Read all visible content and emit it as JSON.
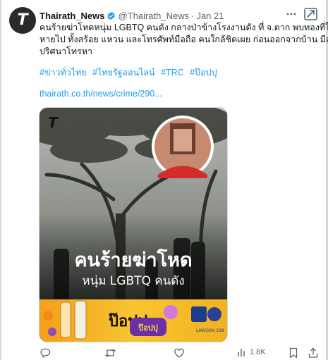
{
  "author": {
    "display_name": "Thairath_News",
    "handle": "@Thairath_News",
    "separator": "·",
    "date": "Jan 21",
    "avatar_letter": "T"
  },
  "tweet": {
    "lines": [
      "คนร้ายฆ่าโหดหนุ่ม LGBTQ คนดัง กลางป่าข้างโรงงานดัง ที่ จ.ตาก พบทองที่ใส่",
      "หายไป ทั้งสร้อย แหวน และโทรศัพท์มือถือ คนใกล้ชิดเผย ก่อนออกจากบ้าน มีสาย",
      "ปริศนาโทรหา"
    ],
    "hashtags": [
      "#ข่าวทั่วไทย",
      "#ไทยรัฐออนไลน์",
      "#TRC",
      "#ป๊อปปุ"
    ],
    "link": "thairath.co.th/news/crime/290..."
  },
  "media": {
    "logo_letter": "T",
    "headline": "คนร้ายฆ่าโหด",
    "subheadline": "หนุ่ม LGBTQ คนดัง",
    "banner_text_1": "ป๊อปปุ",
    "banner_text_2": "ป๊อปปุ",
    "banner_badge_label": "LAWSON 108"
  },
  "actions": {
    "reply_count": "",
    "retweet_count": "",
    "like_count": "",
    "views_count": "1.8K"
  },
  "colors": {
    "link": "#1d9bf0",
    "verified": "#1d9bf0",
    "secondary_text": "#536471"
  }
}
